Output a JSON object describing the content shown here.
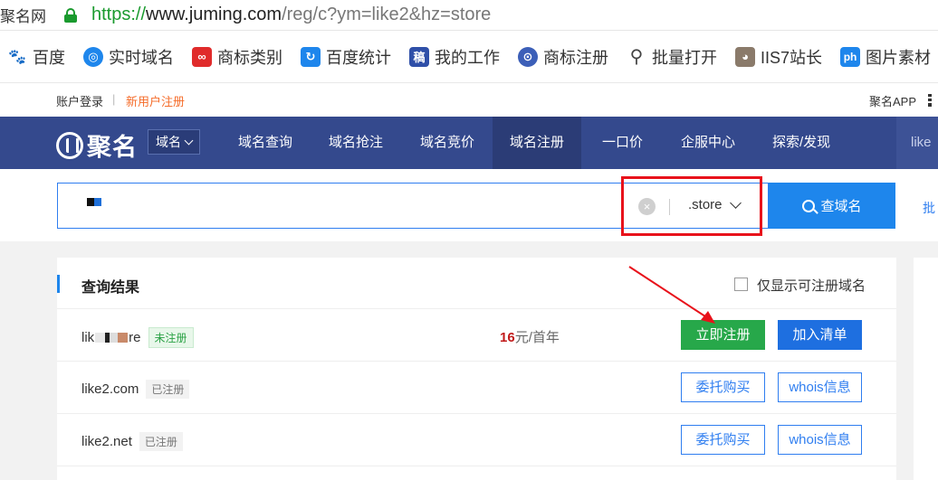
{
  "browser": {
    "tab_title": "聚名网",
    "url_scheme": "https://",
    "url_host": "www.juming.com",
    "url_path": "/reg/c?ym=like2&hz=store"
  },
  "bookmarks": [
    {
      "label": "百度",
      "icon": "baidu-icon",
      "color": "#2f6fe0"
    },
    {
      "label": "实时域名",
      "icon": "realtime-domain-icon",
      "color": "#1e86ec"
    },
    {
      "label": "商标类别",
      "icon": "trademark-class-icon",
      "color": "#e02b2b"
    },
    {
      "label": "百度统计",
      "icon": "baidu-stats-icon",
      "color": "#1e86ec"
    },
    {
      "label": "我的工作",
      "icon": "work-icon",
      "color": "#2f4fa8"
    },
    {
      "label": "商标注册",
      "icon": "trademark-reg-icon",
      "color": "#3c5fb8"
    },
    {
      "label": "批量打开",
      "icon": "search-icon",
      "color": "#444"
    },
    {
      "label": "IIS7站长",
      "icon": "husky-icon",
      "color": "#8a7a6a"
    },
    {
      "label": "图片素材",
      "icon": "ph-icon",
      "color": "#1e86ec"
    }
  ],
  "topstrip": {
    "login": "账户登录",
    "separator": "|",
    "register": "新用户注册",
    "app": "聚名APP"
  },
  "nav": {
    "logo": "聚名",
    "category": "域名",
    "items": [
      "域名查询",
      "域名抢注",
      "域名竞价",
      "域名注册",
      "一口价",
      "企服中心",
      "探索/发现"
    ],
    "active": "域名注册",
    "right_partial": "like"
  },
  "search": {
    "input_value": "",
    "clear_symbol": "×",
    "suffix": ".store",
    "button_label": "查域名",
    "batch_link": "批"
  },
  "results": {
    "title": "查询结果",
    "filter_label": "仅显示可注册域名",
    "rows": [
      {
        "name_prefix": "lik",
        "name_suffix": "re",
        "status": "未注册",
        "status_type": "free",
        "price_num": "16",
        "price_unit": "元/首年",
        "btn1": "立即注册",
        "btn2": "加入清单"
      },
      {
        "name": "like2.com",
        "status": "已注册",
        "status_type": "taken",
        "btn1": "委托购买",
        "btn2": "whois信息"
      },
      {
        "name": "like2.net",
        "status": "已注册",
        "status_type": "taken",
        "btn1": "委托购买",
        "btn2": "whois信息"
      }
    ]
  },
  "colors": {
    "nav_bg": "#34498d",
    "accent_blue": "#1e86ec",
    "register_green": "#27a84a",
    "highlight_red": "#e8121b",
    "link_orange": "#f56c2a"
  }
}
